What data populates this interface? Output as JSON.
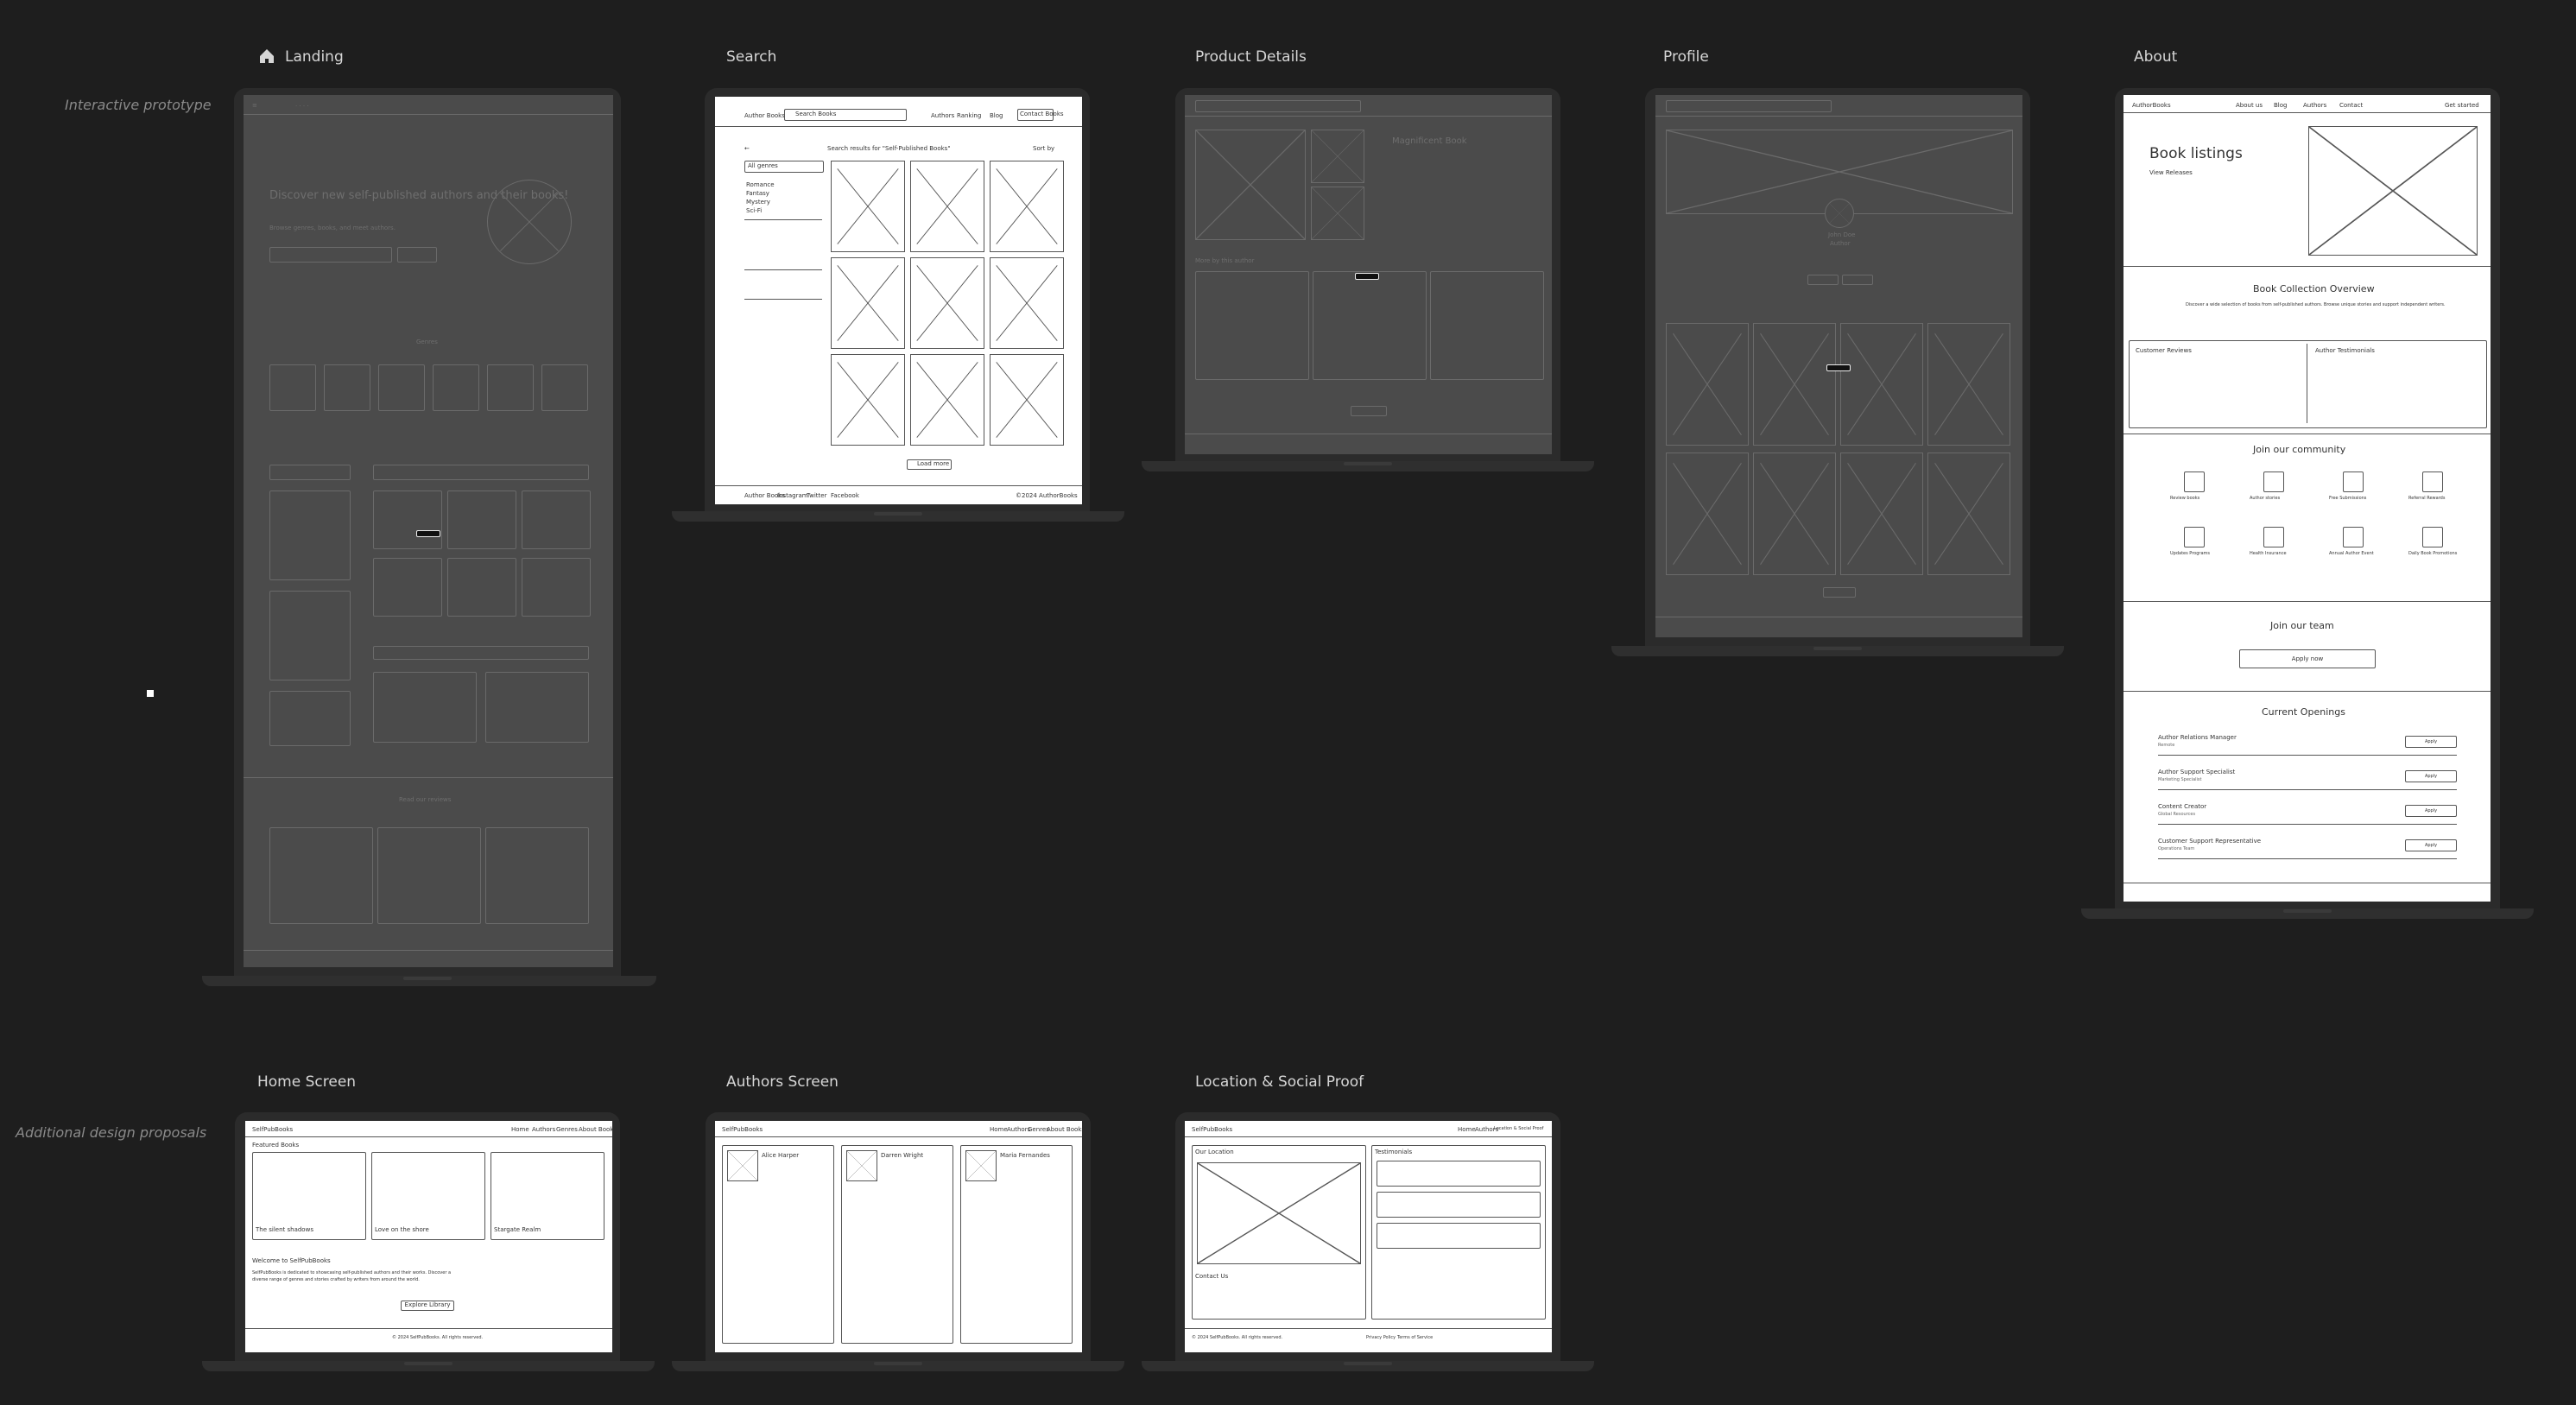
{
  "side_labels": {
    "interactive": "Interactive prototype",
    "additional": "Additional design proposals"
  },
  "frames": {
    "landing": {
      "title": "Landing",
      "hero": "Discover new self-published authors and their books!",
      "hero_sub": "Browse genres, books, and meet authors.",
      "genres_label": "Genres",
      "news_label": "Read our reviews"
    },
    "search": {
      "title": "Search",
      "brand": "Author Books",
      "search_value": "Search Books",
      "nav": [
        "Authors",
        "Ranking",
        "Blog",
        "Contact Books"
      ],
      "results_heading": "Search results for \"Self-Published Books\"",
      "sort": "Sort by",
      "filter_genre": "All genres",
      "filters": [
        "Romance",
        "Fantasy",
        "Mystery",
        "Sci-Fi"
      ],
      "load_more": "Load more",
      "footer": [
        "Author Books",
        "Instagram",
        "Twitter",
        "Facebook",
        "©2024 AuthorBooks"
      ]
    },
    "product": {
      "title": "Product Details",
      "book_title": "Magnificent Book",
      "more_label": "More by this author"
    },
    "profile": {
      "title": "Profile",
      "name": "John Doe",
      "role": "Author"
    },
    "about": {
      "title": "About",
      "brand": "AuthorBooks",
      "nav": [
        "About us",
        "Blog",
        "Authors",
        "Contact"
      ],
      "cta": "Get started",
      "heading": "Book listings",
      "sub": "View Releases",
      "overview_title": "Book Collection Overview",
      "overview_text": "Discover a wide selection of books from self-published authors. Browse unique stories and support independent writers.",
      "reviews_label": "Customer Reviews",
      "testimonials_label": "Author Testimonials",
      "community_title": "Join our community",
      "community_items": [
        "Review books",
        "Author stories",
        "Free Submissions",
        "Referral Rewards",
        "Updates Programs",
        "Health Insurance",
        "Annual Author Event",
        "Daily Book Promotions"
      ],
      "team_title": "Join our team",
      "team_button": "Apply now",
      "openings_title": "Current Openings",
      "openings": [
        {
          "role": "Author Relations Manager",
          "loc": "Remote"
        },
        {
          "role": "Author Support Specialist",
          "loc": "Marketing Specialist"
        },
        {
          "role": "Content Creator",
          "loc": "Global Resources"
        },
        {
          "role": "Customer Support Representative",
          "loc": "Operations Team"
        }
      ],
      "apply": "Apply"
    },
    "home": {
      "title": "Home Screen",
      "brand": "SelfPubBooks",
      "nav": [
        "Home",
        "Authors",
        "Genres",
        "About Books"
      ],
      "featured": "Featured Books",
      "cards": [
        "The silent shadows",
        "Love on the shore",
        "Stargate Realm"
      ],
      "welcome_title": "Welcome to SelfPubBooks",
      "welcome_text": "SelfPubBooks is dedicated to showcasing self-published authors and their works. Discover a diverse range of genres and stories crafted by writers from around the world.",
      "button": "Explore Library",
      "footer": "© 2024 SelfPubBooks. All rights reserved."
    },
    "authors": {
      "title": "Authors Screen",
      "brand": "SelfPubBooks",
      "nav": [
        "Home",
        "Authors",
        "Genres",
        "About Books"
      ],
      "authors": [
        "Alice Harper",
        "Darren Wright",
        "Maria Fernandes"
      ]
    },
    "location": {
      "title": "Location & Social Proof",
      "brand": "SelfPubBooks",
      "nav": [
        "Home",
        "Authors",
        "Location & Social Proof"
      ],
      "our_location": "Our Location",
      "testimonials": "Testimonials",
      "contact": "Contact Us",
      "footer_left": "© 2024 SelfPubBooks. All rights reserved.",
      "footer_links": [
        "Privacy Policy",
        "Terms of Service"
      ]
    }
  },
  "colors": {
    "background": "#1e1e1e",
    "device": "#2b2b2b",
    "dim_screen": "#4b4b4b",
    "light_screen": "#ffffff"
  }
}
